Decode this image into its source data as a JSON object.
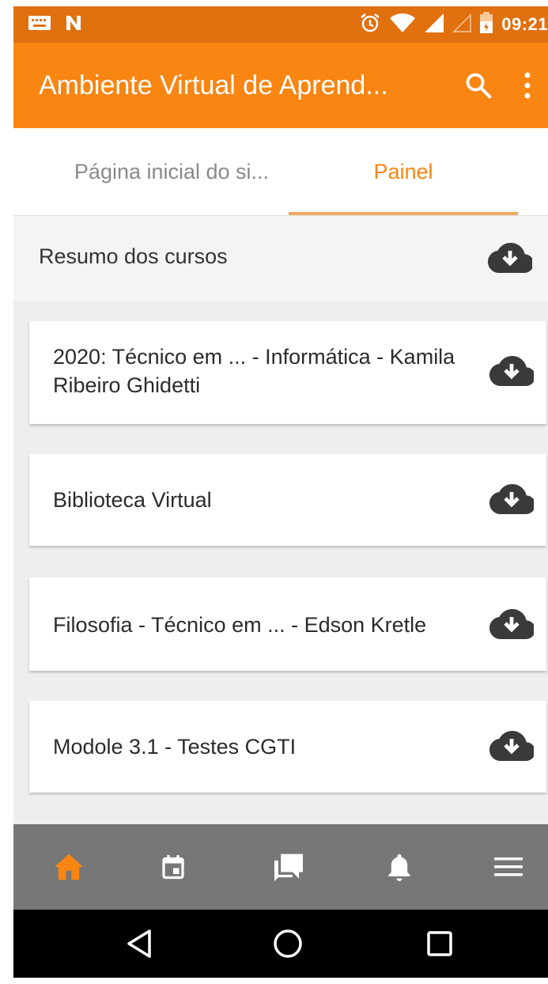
{
  "status_bar": {
    "time": "09:21",
    "icons": [
      "keyboard-icon",
      "n-notification-icon",
      "alarm-icon",
      "wifi-icon",
      "signal-icon",
      "signal-empty-icon",
      "battery-icon"
    ]
  },
  "app_bar": {
    "title": "Ambiente Virtual de Aprend...",
    "icons": [
      "search-icon",
      "more-vert-icon"
    ]
  },
  "tabs": [
    {
      "label": "Página inicial do si...",
      "selected": false
    },
    {
      "label": "Painel",
      "selected": true
    }
  ],
  "summary": {
    "label": "Resumo dos cursos",
    "icon": "cloud-download-icon"
  },
  "courses": [
    {
      "name": "2020: Técnico em ... - Informática - Kamila Ribeiro Ghidetti",
      "icon": "cloud-download-icon"
    },
    {
      "name": "Biblioteca Virtual",
      "icon": "cloud-download-icon"
    },
    {
      "name": "Filosofia - Técnico em ... - Edson Kretle",
      "icon": "cloud-download-icon"
    },
    {
      "name": "Modole 3.1 - Testes CGTI",
      "icon": "cloud-download-icon"
    }
  ],
  "bottom_nav": {
    "items": [
      "home-icon",
      "calendar-icon",
      "messages-icon",
      "notifications-icon",
      "menu-icon"
    ],
    "active_index": 0
  },
  "system_nav": [
    "back-icon",
    "home-circle-icon",
    "recent-apps-icon"
  ],
  "colors": {
    "accent": "#f98512",
    "status_bar": "#e1700f",
    "bottom_nav": "#777777",
    "text": "#2b2b2b"
  }
}
